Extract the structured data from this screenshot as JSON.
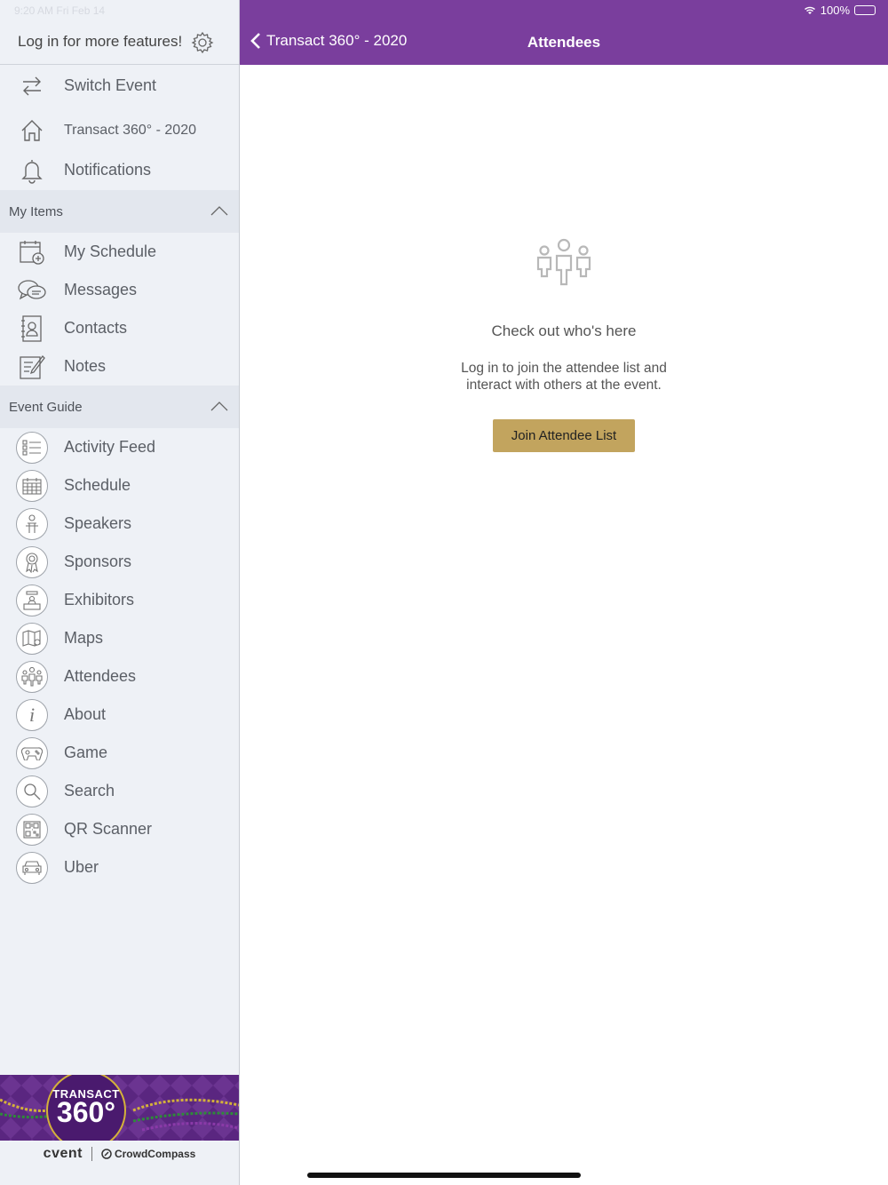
{
  "status": {
    "time_date": "9:20 AM  Fri Feb 14",
    "battery_pct": "100%",
    "battery_level": 1.0
  },
  "sidebar": {
    "login_text": "Log in for more features!",
    "top_items": [
      {
        "label": "Switch Event",
        "icon": "switch-icon"
      },
      {
        "label": "Transact 360° - 2020",
        "icon": "home-icon"
      },
      {
        "label": "Notifications",
        "icon": "bell-icon"
      }
    ],
    "my_items_header": "My Items",
    "my_items": [
      {
        "label": "My Schedule",
        "icon": "calendar-plus-icon"
      },
      {
        "label": "Messages",
        "icon": "chat-icon"
      },
      {
        "label": "Contacts",
        "icon": "contacts-icon"
      },
      {
        "label": "Notes",
        "icon": "notes-icon"
      }
    ],
    "event_guide_header": "Event Guide",
    "event_guide": [
      {
        "label": "Activity Feed",
        "icon": "list-icon"
      },
      {
        "label": "Schedule",
        "icon": "calendar-icon"
      },
      {
        "label": "Speakers",
        "icon": "speaker-icon"
      },
      {
        "label": "Sponsors",
        "icon": "ribbon-icon"
      },
      {
        "label": "Exhibitors",
        "icon": "booth-icon"
      },
      {
        "label": "Maps",
        "icon": "map-icon"
      },
      {
        "label": "Attendees",
        "icon": "people-icon"
      },
      {
        "label": "About",
        "icon": "info-icon"
      },
      {
        "label": "Game",
        "icon": "gamepad-icon"
      },
      {
        "label": "Search",
        "icon": "search-icon"
      },
      {
        "label": "QR Scanner",
        "icon": "qr-icon"
      },
      {
        "label": "Uber",
        "icon": "car-icon"
      }
    ],
    "banner": {
      "line1": "TRANSACT",
      "line2": "360°"
    },
    "footer": {
      "left": "cvent",
      "right": "CrowdCompass"
    }
  },
  "topbar": {
    "back_label": "Transact 360° - 2020",
    "title": "Attendees",
    "color": "#7a3e9d"
  },
  "main": {
    "heading": "Check out who's here",
    "body_line1": "Log in to join the attendee list and",
    "body_line2": "interact with others at the event.",
    "button_label": "Join Attendee List",
    "button_color": "#c2a45e"
  }
}
